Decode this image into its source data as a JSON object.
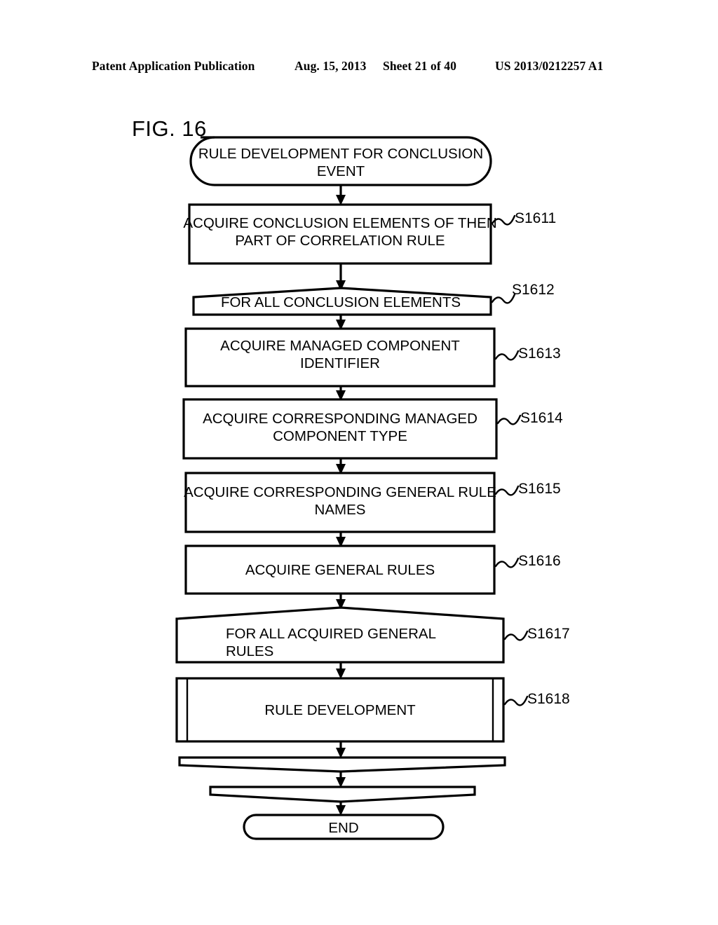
{
  "header": {
    "publication": "Patent Application Publication",
    "date": "Aug. 15, 2013",
    "sheet": "Sheet 21 of 40",
    "patent_number": "US 2013/0212257 A1"
  },
  "figure": {
    "label": "FIG. 16"
  },
  "flowchart": {
    "start": {
      "shape": "terminator",
      "line1": "RULE DEVELOPMENT FOR CONCLUSION",
      "line2": "EVENT"
    },
    "steps": [
      {
        "id": "S1611",
        "shape": "process",
        "line1": "ACQUIRE CONCLUSION ELEMENTS OF THEN",
        "line2": "PART OF CORRELATION RULE"
      },
      {
        "id": "S1612",
        "shape": "loop-start",
        "line1": "FOR ALL CONCLUSION ELEMENTS",
        "line2": ""
      },
      {
        "id": "S1613",
        "shape": "process",
        "line1": "ACQUIRE MANAGED COMPONENT",
        "line2": "IDENTIFIER"
      },
      {
        "id": "S1614",
        "shape": "process",
        "line1": "ACQUIRE CORRESPONDING MANAGED",
        "line2": "COMPONENT TYPE"
      },
      {
        "id": "S1615",
        "shape": "process",
        "line1": "ACQUIRE CORRESPONDING GENERAL RULE",
        "line2": "NAMES"
      },
      {
        "id": "S1616",
        "shape": "process",
        "line1": "ACQUIRE GENERAL RULES",
        "line2": ""
      },
      {
        "id": "S1617",
        "shape": "loop-start",
        "line1": "FOR ALL ACQUIRED GENERAL",
        "line2": "RULES"
      },
      {
        "id": "S1618",
        "shape": "predefined-process",
        "line1": "RULE DEVELOPMENT",
        "line2": ""
      }
    ],
    "loop_ends": [
      {
        "id": "loop-end-outer",
        "shape": "loop-end",
        "label": ""
      },
      {
        "id": "loop-end-inner",
        "shape": "loop-end",
        "label": ""
      }
    ],
    "end": {
      "shape": "terminator",
      "label": "END"
    }
  },
  "colors": {
    "stroke": "#000000",
    "fill": "#ffffff",
    "text": "#000000"
  }
}
